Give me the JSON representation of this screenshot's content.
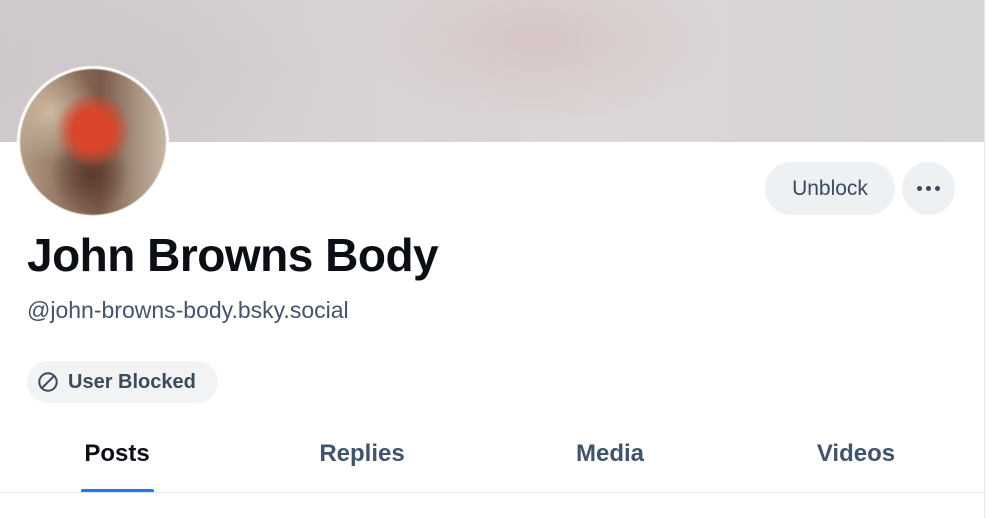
{
  "profile": {
    "display_name": "John Browns Body",
    "handle": "@john-browns-body.bsky.social"
  },
  "actions": {
    "unblock_label": "Unblock",
    "more_icon": "more-horizontal-icon"
  },
  "status": {
    "blocked_label": "User Blocked",
    "blocked_icon": "block-icon"
  },
  "tabs": [
    {
      "label": "Posts",
      "active": true
    },
    {
      "label": "Replies",
      "active": false
    },
    {
      "label": "Media",
      "active": false
    },
    {
      "label": "Videos",
      "active": false
    }
  ],
  "colors": {
    "accent": "#1f7be8",
    "text_primary": "#0b0f14",
    "text_secondary": "#42546b",
    "button_bg": "#eef1f4"
  }
}
